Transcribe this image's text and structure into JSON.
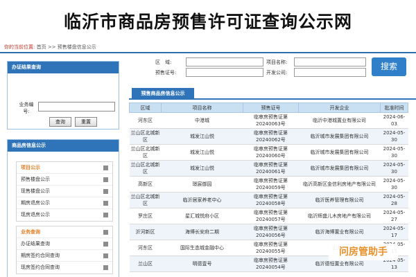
{
  "banner": {
    "title": "临沂市商品房预售许可证查询公示网"
  },
  "breadcrumb": {
    "label": "你的当前位置:",
    "home": "首页 >>",
    "current": "预售楼盘信息公示"
  },
  "sidebar": {
    "search_title": "办证结果查询",
    "number_label": "业务编号:",
    "query_button": "查询",
    "reset_button": "重置",
    "info_title": "商品房信息公示",
    "groups": [
      {
        "title": "项目公示",
        "items": [
          "预售楼盘公示",
          "现售楼盘公示",
          "期房退房公示",
          "现房退房公示"
        ]
      },
      {
        "title": "业务查询",
        "items": [
          "办证结果查询",
          "期房签约合同查询",
          "现房签约合同查询"
        ]
      }
    ]
  },
  "form": {
    "district_label": "区　域:",
    "permit_label": "预售证号:",
    "project_label": "项目名称:",
    "developer_label": "开发公司:",
    "search_button": "搜索"
  },
  "tab": {
    "label": "预售商品房信息公示"
  },
  "table": {
    "headers": [
      "区域",
      "项目名称",
      "预售证号",
      "开发企业",
      "批准时间"
    ],
    "rows": [
      [
        "河东区",
        "中港城",
        "临审房预售证第20240063号",
        "临沂中港城置业有限公司",
        "2024-06-03"
      ],
      [
        "兰山区北城新区",
        "城发江山悦",
        "临审房预售证第20240062号",
        "临沂城市发展集团有限公司",
        "2024-05-30"
      ],
      [
        "兰山区北城新区",
        "城发江山悦",
        "临审房预售证第20240060号",
        "临沂城市发展集团有限公司",
        "2024-05-30"
      ],
      [
        "兰山区北城新区",
        "城发江山悦",
        "临审房预售证第20240061号",
        "临沂城市发展集团有限公司",
        "2024-05-30"
      ],
      [
        "高新区",
        "璟宸御园",
        "临审房预售证第20240059号",
        "临沂高新区金信利房地产有限公司",
        "2024-05-30"
      ],
      [
        "兰山区北城新区",
        "临沂居家养老中心",
        "临审房预售证第20240058号",
        "临沂医养管理有限公司",
        "2024-05-28"
      ],
      [
        "罗庄区",
        "星汇城悦府小区",
        "临审房预售证第20240057号",
        "临沂辉盛儿木房地产有限公司",
        "2024-05-27"
      ],
      [
        "沂河新区",
        "海博长安府二期",
        "临审房预售证第20240056号",
        "临沂海博置业有限公司",
        "2024-05-17"
      ],
      [
        "河东区",
        "国际生态城金融中心",
        "临审房预售证第20240055号",
        "山东...",
        "2024-05-15"
      ],
      [
        "兰山区",
        "明德壹号",
        "临审房预售证第20240054号",
        "临沂德恒置业有限公司",
        "2024-05-13"
      ]
    ]
  },
  "watermark": {
    "text": "问房管助手"
  }
}
